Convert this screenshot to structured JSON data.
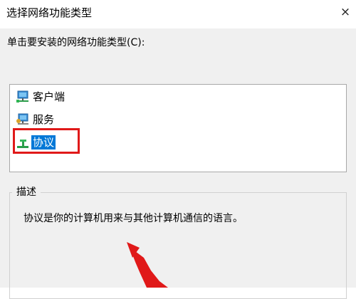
{
  "window": {
    "title": "选择网络功能类型",
    "close_icon": "×"
  },
  "list": {
    "prompt": "单击要安装的网络功能类型(C):",
    "items": [
      {
        "label": "客户端",
        "icon": "network-client-icon",
        "selected": false
      },
      {
        "label": "服务",
        "icon": "network-service-icon",
        "selected": false
      },
      {
        "label": "协议",
        "icon": "network-protocol-icon",
        "selected": true
      }
    ]
  },
  "description": {
    "title": "描述",
    "text": "协议是你的计算机用来与其他计算机通信的语言。"
  },
  "colors": {
    "selection": "#0078d7",
    "highlight_annotation": "#e01919",
    "arrow_annotation": "#e01919"
  }
}
